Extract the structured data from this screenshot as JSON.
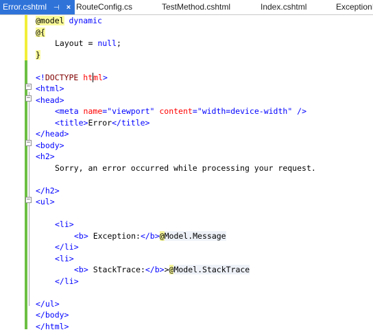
{
  "tabs": [
    {
      "label": "Error.cshtml",
      "active": true
    },
    {
      "label": "RouteConfig.cs",
      "active": false
    },
    {
      "label": "TestMethod.cshtml",
      "active": false
    },
    {
      "label": "Index.cshtml",
      "active": false
    },
    {
      "label": "ExceptionI",
      "active": false
    }
  ],
  "code": {
    "l1_at": "@model",
    "l1_type": " dynamic",
    "l2": "@{",
    "l3_name": "Layout",
    "l3_eq": " = ",
    "l3_null": "null",
    "l3_semi": ";",
    "l4": "}",
    "l6_open": "<!",
    "l6_doctype": "DOCTYPE",
    "l6_sp": " ",
    "l6_html_a": "ht",
    "l6_html_b": "ml",
    "l6_close": ">",
    "l7": "<html>",
    "l8": "<head>",
    "l9_open": "<meta",
    "l9_attr1": " name",
    "l9_eq1": "=",
    "l9_val1": "\"viewport\"",
    "l9_attr2": " content",
    "l9_eq2": "=",
    "l9_val2": "\"width=device-width\"",
    "l9_close": " />",
    "l10_open": "<title>",
    "l10_text": "Error",
    "l10_close": "</title>",
    "l11": "</head>",
    "l12": "<body>",
    "l13": "<h2>",
    "l14": "Sorry, an error occurred while processing your request.",
    "l16": "</h2>",
    "l17": "<ul>",
    "l19": "<li>",
    "l20_b": "<b>",
    "l20_text": " Exception:",
    "l20_bc": "</b>",
    "l20_at": "@",
    "l20_model": "Model.Message",
    "l21": "</li>",
    "l22": "<li>",
    "l23_b": "<b>",
    "l23_text": " StackTrace:",
    "l23_bc": "</b>",
    "l23_gt": ">",
    "l23_at": "@",
    "l23_model": "Model.StackTrace",
    "l24": "</li>",
    "l26": "</ul>",
    "l27": "</body>",
    "l28": "</html>"
  },
  "fold_symbol": "−",
  "pin_icon": "⊣",
  "close_icon": "×"
}
